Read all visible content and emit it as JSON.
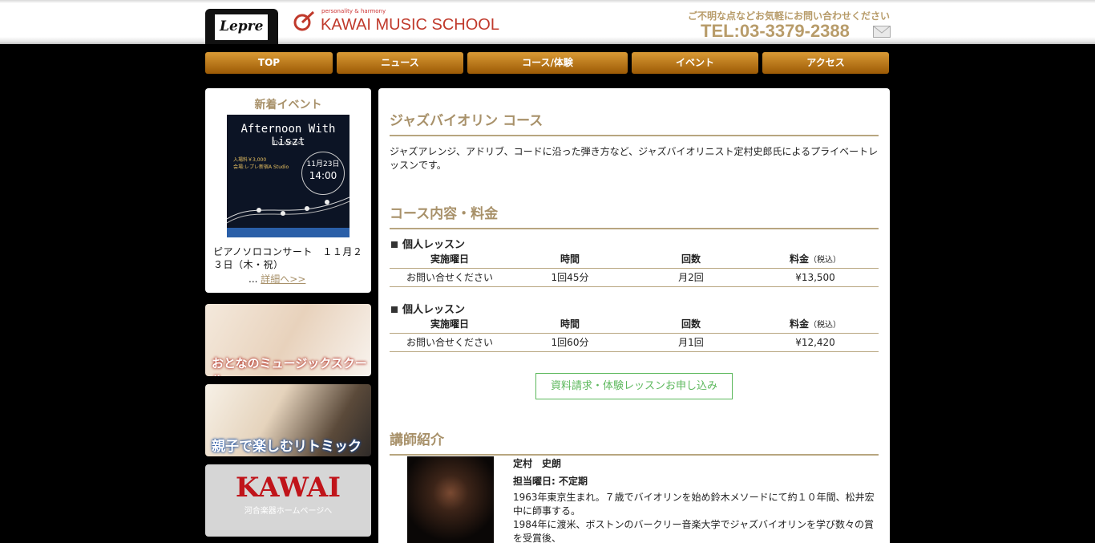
{
  "header": {
    "lepre_logo_text": "Lepre",
    "kawai_tagline": "personality & harmony",
    "kawai_name": "KAWAI MUSIC SCHOOL",
    "contact_note": "ご不明な点などお気軽にお問い合わせください",
    "tel": "TEL:03-3379-2388",
    "mail_icon": "envelope-icon"
  },
  "nav": {
    "items": [
      {
        "label": "TOP"
      },
      {
        "label": "ニュース"
      },
      {
        "label": "コース/体験"
      },
      {
        "label": "イベント"
      },
      {
        "label": "アクセス"
      }
    ]
  },
  "sidebar": {
    "event_title": "新着イベント",
    "poster": {
      "title": "Afternoon With Liszt",
      "subtitle": "The virtuoso",
      "date": "11月23日",
      "time": "14:00",
      "info": "入場料￥3,000\n会場:レプレ新宿A Studio"
    },
    "event_text": "ピアノソロコンサート　１１月２３日（木・祝）",
    "event_more_prefix": "...",
    "event_more_link": "詳細へ>>",
    "banner1_text": "おとなのミュージックスクール",
    "banner2_text": "親子で楽しむリトミック",
    "banner3_logo": "KAWAI",
    "banner3_caption": "河合楽器ホームページへ"
  },
  "main": {
    "course_heading": "ジャズバイオリン コース",
    "description": "ジャズアレンジ、アドリブ、コードに沿った弾き方など、ジャズバイオリニスト定村史郎氏によるプライベートレッスンです。",
    "fee_heading": "コース内容・料金",
    "courses": [
      {
        "title": "個人レッスン",
        "headers": [
          "実施曜日",
          "時間",
          "回数",
          "料金"
        ],
        "price_note": "（税込）",
        "row": [
          "お問い合せください",
          "1回45分",
          "月2回",
          "¥13,500"
        ]
      },
      {
        "title": "個人レッスン",
        "headers": [
          "実施曜日",
          "時間",
          "回数",
          "料金"
        ],
        "price_note": "（税込）",
        "row": [
          "お問い合せください",
          "1回60分",
          "月1回",
          "¥12,420"
        ]
      }
    ],
    "apply_button": "資料請求・体験レッスンお申し込み",
    "teacher_heading": "講師紹介",
    "teacher_name": "定村　史朗",
    "teacher_day": "担当曜日: 不定期",
    "teacher_bio": "1963年東京生まれ。７歳でバイオリンを始め鈴木メソードにて約１０年間、松井宏中に師事する。\n1984年に渡米、ボストンのバークリー音楽大学でジャズバイオリンを学び数々の賞を受賞後、"
  },
  "colors": {
    "accent_gold": "#a8916a",
    "nav_orange": "#c07a18",
    "apply_green": "#5cb85c",
    "kawai_red": "#c0392b"
  }
}
